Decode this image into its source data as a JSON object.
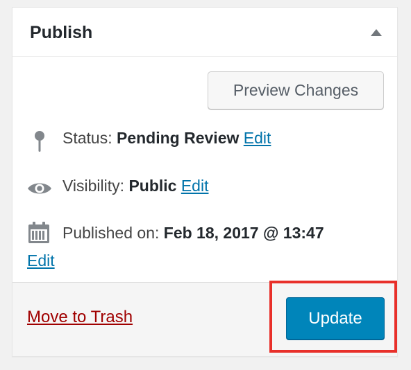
{
  "publish_box": {
    "title": "Publish",
    "toggle_icon": "triangle-up-icon"
  },
  "preview_button": {
    "label": "Preview Changes"
  },
  "status": {
    "icon": "pin-icon",
    "label": "Status:",
    "value": "Pending Review",
    "edit": "Edit"
  },
  "visibility": {
    "icon": "eye-icon",
    "label": "Visibility:",
    "value": "Public",
    "edit": "Edit"
  },
  "published": {
    "icon": "calendar-icon",
    "label": "Published on:",
    "value": "Feb 18, 2017 @ 13:47",
    "edit": "Edit"
  },
  "footer": {
    "trash_label": "Move to Trash",
    "update_label": "Update"
  },
  "colors": {
    "primary_button": "#0085ba",
    "link": "#0073aa",
    "trash_link": "#a00000",
    "highlight_border": "#e8302a"
  }
}
